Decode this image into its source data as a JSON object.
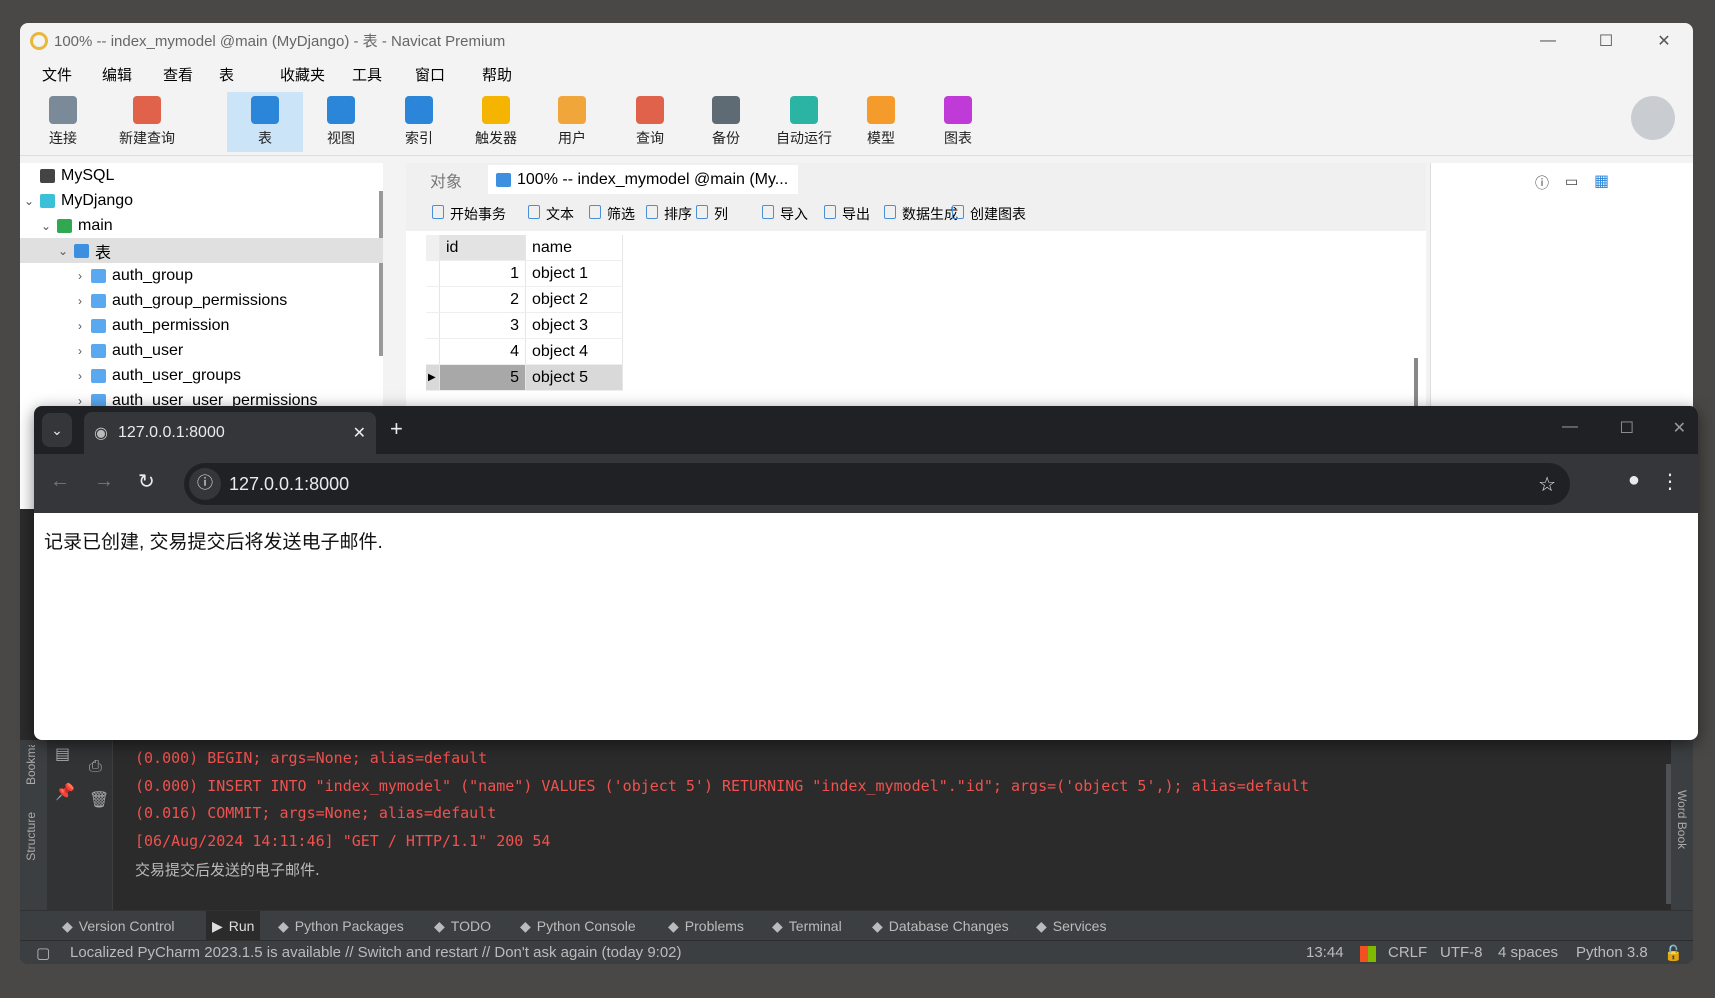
{
  "navicat": {
    "title": "100% -- index_mymodel @main (MyDjango) - 表 - Navicat Premium",
    "menu": [
      "文件",
      "编辑",
      "查看",
      "表",
      "收藏夹",
      "工具",
      "窗口",
      "帮助"
    ],
    "toolbar": [
      {
        "label": "连接",
        "icon": "plug-icon",
        "color": "#7a8a99"
      },
      {
        "label": "新建查询",
        "icon": "new-query-icon",
        "color": "#e0624a"
      },
      {
        "label": "表",
        "icon": "table-icon",
        "color": "#2b86d9"
      },
      {
        "label": "视图",
        "icon": "view-icon",
        "color": "#2b86d9"
      },
      {
        "label": "索引",
        "icon": "index-az-icon",
        "color": "#2b86d9"
      },
      {
        "label": "触发器",
        "icon": "lightning-icon",
        "color": "#f5b400"
      },
      {
        "label": "用户",
        "icon": "user-icon",
        "color": "#f0a63a"
      },
      {
        "label": "查询",
        "icon": "query-icon",
        "color": "#e0624a"
      },
      {
        "label": "备份",
        "icon": "backup-icon",
        "color": "#5e6b75"
      },
      {
        "label": "自动运行",
        "icon": "robot-icon",
        "color": "#2bb3a3"
      },
      {
        "label": "模型",
        "icon": "model-icon",
        "color": "#f59b2b"
      },
      {
        "label": "图表",
        "icon": "chart-icon",
        "color": "#c03ad8"
      }
    ],
    "tree": [
      {
        "label": "MySQL",
        "level": 0,
        "expanded": null,
        "icon": "mysql-icon"
      },
      {
        "label": "MyDjango",
        "level": 0,
        "expanded": true,
        "icon": "sqlite-icon"
      },
      {
        "label": "main",
        "level": 1,
        "expanded": true,
        "icon": "database-icon"
      },
      {
        "label": "表",
        "level": 2,
        "expanded": true,
        "icon": "tables-folder-icon",
        "selected": true
      },
      {
        "label": "auth_group",
        "level": 3,
        "expanded": false,
        "icon": "table-icon"
      },
      {
        "label": "auth_group_permissions",
        "level": 3,
        "expanded": false,
        "icon": "table-icon"
      },
      {
        "label": "auth_permission",
        "level": 3,
        "expanded": false,
        "icon": "table-icon"
      },
      {
        "label": "auth_user",
        "level": 3,
        "expanded": false,
        "icon": "table-icon"
      },
      {
        "label": "auth_user_groups",
        "level": 3,
        "expanded": false,
        "icon": "table-icon"
      },
      {
        "label": "auth_user_user_permissions",
        "level": 3,
        "expanded": false,
        "icon": "table-icon"
      }
    ],
    "tabs": {
      "objects": "对象",
      "active": "100% -- index_mymodel @main (My..."
    },
    "grid_toolbar": [
      "开始事务",
      "文本",
      "筛选",
      "排序",
      "列",
      "导入",
      "导出",
      "数据生成",
      "创建图表"
    ],
    "grid": {
      "columns": [
        "id",
        "name"
      ],
      "rows": [
        [
          "1",
          "object 1"
        ],
        [
          "2",
          "object 2"
        ],
        [
          "3",
          "object 3"
        ],
        [
          "4",
          "object 4"
        ],
        [
          "5",
          "object 5"
        ]
      ],
      "selected_row": 5
    }
  },
  "browser": {
    "tab_title": "127.0.0.1:8000",
    "url": "127.0.0.1:8000",
    "content": "记录已创建, 交易提交后将发送电子邮件."
  },
  "pycharm": {
    "console": [
      "(0.000) BEGIN; args=None; alias=default",
      "(0.000) INSERT INTO \"index_mymodel\" (\"name\") VALUES ('object 5') RETURNING \"index_mymodel\".\"id\"; args=('object 5',); alias=default",
      "(0.016) COMMIT; args=None; alias=default",
      "[06/Aug/2024 14:11:46] \"GET / HTTP/1.1\" 200 54",
      "交易提交后发送的电子邮件."
    ],
    "side_left": [
      "Bookmarks",
      "Structure"
    ],
    "side_right": "Word Book",
    "tool_windows": [
      "Version Control",
      "Run",
      "Python Packages",
      "TODO",
      "Python Console",
      "Problems",
      "Terminal",
      "Database Changes",
      "Services"
    ],
    "status": {
      "message": "Localized PyCharm 2023.1.5 is available // Switch and restart // Don't ask again (today 9:02)",
      "position": "13:44",
      "line_sep": "CRLF",
      "encoding": "UTF-8",
      "indent": "4 spaces",
      "interpreter": "Python 3.8"
    },
    "colors": {
      "console_error": "#f0524f",
      "console_text": "#bbbbbb"
    }
  }
}
